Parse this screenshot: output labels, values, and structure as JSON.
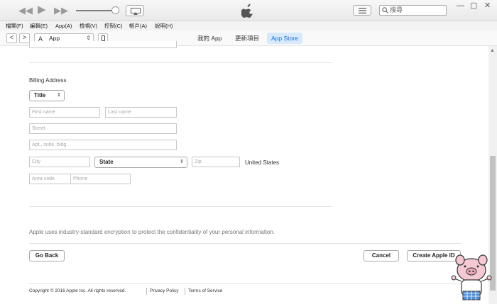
{
  "search": {
    "placeholder": "搜尋"
  },
  "window_controls": {
    "minimize": "—",
    "maximize": "▢",
    "close": "✕"
  },
  "menu": [
    "檔案(F)",
    "編輯(E)",
    "App(A)",
    "檢視(V)",
    "控制(C)",
    "帳戶(A)",
    "說明(H)"
  ],
  "nav": {
    "back": "<",
    "forward": ">",
    "media_type": "App",
    "tabs": [
      "我的 App",
      "更新項目",
      "App Store"
    ],
    "active_tab": "App Store"
  },
  "form": {
    "section_title": "Billing Address",
    "title_select": "Title",
    "first_name_placeholder": "First name",
    "last_name_placeholder": "Last name",
    "street_placeholder": "Street",
    "apt_placeholder": "Apt., suite, bldg.",
    "city_placeholder": "City",
    "state_select": "State",
    "zip_placeholder": "Zip",
    "country": "United States",
    "area_code_placeholder": "Area code",
    "phone_placeholder": "Phone"
  },
  "encryption_note": "Apple uses industry-standard encryption to protect the confidentiality of your personal information.",
  "buttons": {
    "go_back": "Go Back",
    "cancel": "Cancel",
    "create": "Create Apple ID"
  },
  "footer": {
    "copyright": "Copyright © 2016 Apple Inc. All rights reserved.",
    "privacy": "Privacy Policy",
    "terms": "Terms of Service"
  },
  "colors": {
    "accent": "#1d6fd6",
    "tab_active_bg": "#d7e9fb"
  }
}
